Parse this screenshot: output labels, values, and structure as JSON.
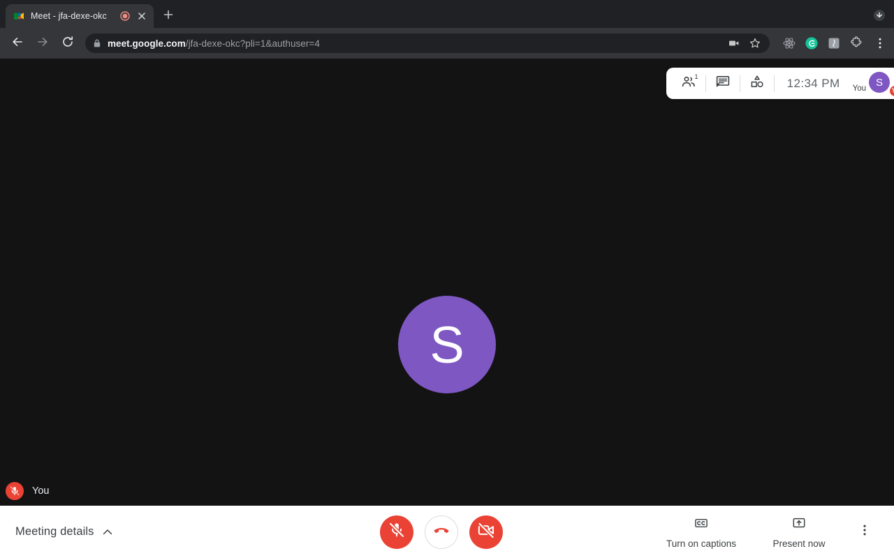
{
  "browser": {
    "tab": {
      "title": "Meet - jfa-dexe-okc",
      "favicon_icon": "google-meet-favicon",
      "recording_icon": "recording-indicator-icon",
      "close_icon": "close-icon"
    },
    "new_tab_icon": "plus-icon",
    "tabstrip_right_icon": "download-chevron-icon",
    "nav": {
      "back_icon": "back-arrow-icon",
      "forward_icon": "forward-arrow-icon",
      "reload_icon": "reload-icon"
    },
    "omnibox": {
      "lock_icon": "lock-icon",
      "url_host": "meet.google.com",
      "url_path": "/jfa-dexe-okc?pli=1&authuser=4",
      "camera_icon": "camera-in-use-icon",
      "bookmark_icon": "star-bookmark-icon"
    },
    "extensions": [
      {
        "icon": "react-devtools-icon"
      },
      {
        "icon": "grammarly-icon",
        "label": "G"
      },
      {
        "icon": "extension-square-icon"
      },
      {
        "icon": "puzzle-extensions-icon"
      }
    ],
    "menu_icon": "three-dots-vertical-icon"
  },
  "meet": {
    "stage": {
      "background_color": "#131314",
      "avatar": {
        "initial": "S",
        "color": "#7E57C2"
      },
      "self_label": "You",
      "self_mic_icon": "mic-off-icon"
    },
    "top_panel": {
      "people_icon": "people-icon",
      "people_count": "1",
      "chat_icon": "chat-icon",
      "activities_icon": "activities-icon",
      "time": "12:34 PM",
      "you_label": "You",
      "avatar_initial": "S",
      "avatar_color": "#7E57C2",
      "mic_badge_icon": "mic-off-icon"
    },
    "bottom_bar": {
      "meeting_details_label": "Meeting details",
      "meeting_details_chevron": "chevron-up-icon",
      "mic_button": {
        "icon": "mic-off-icon",
        "state": "muted",
        "color": "#EA4335"
      },
      "hangup_button": {
        "icon": "hangup-phone-icon",
        "color": "#EA4335"
      },
      "camera_button": {
        "icon": "videocam-off-icon",
        "state": "off",
        "color": "#EA4335"
      },
      "captions": {
        "icon": "closed-captions-icon",
        "label": "Turn on captions"
      },
      "present": {
        "icon": "present-screen-icon",
        "label": "Present now"
      },
      "more_icon": "three-dots-vertical-icon"
    }
  }
}
